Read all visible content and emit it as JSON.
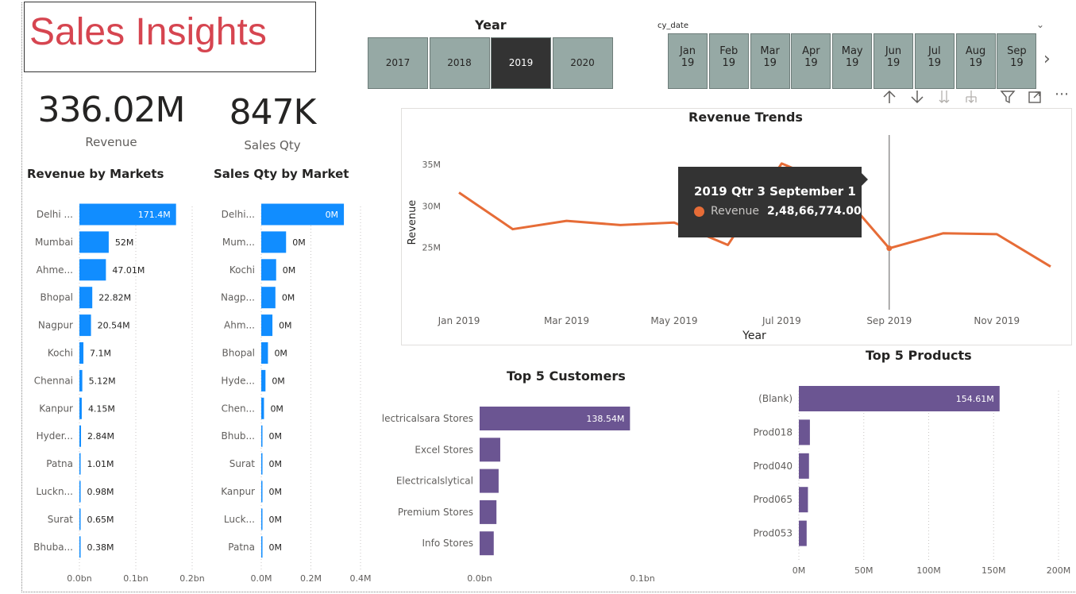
{
  "report": {
    "title": "Sales Insights"
  },
  "kpis": [
    {
      "value": "336.02M",
      "label": "Revenue"
    },
    {
      "value": "847K",
      "label": "Sales Qty"
    }
  ],
  "year_slicer": {
    "title": "Year",
    "years": [
      "2017",
      "2018",
      "2019",
      "2020"
    ],
    "selected": "2019"
  },
  "date_slicer": {
    "title": "cy_date",
    "months": [
      {
        "m": "Jan",
        "y": "19"
      },
      {
        "m": "Feb",
        "y": "19"
      },
      {
        "m": "Mar",
        "y": "19"
      },
      {
        "m": "Apr",
        "y": "19"
      },
      {
        "m": "May",
        "y": "19"
      },
      {
        "m": "Jun",
        "y": "19"
      },
      {
        "m": "Jul",
        "y": "19"
      },
      {
        "m": "Aug",
        "y": "19"
      },
      {
        "m": "Sep",
        "y": "19"
      }
    ]
  },
  "visual_header_icons": [
    "arrow-up-icon",
    "arrow-down-icon",
    "double-arrow-down-icon",
    "expand-hierarchy-icon",
    "filter-icon",
    "focus-mode-icon",
    "more-options-icon"
  ],
  "colors": {
    "blue": "#118dff",
    "orange": "#e66c37",
    "purple": "#6b5592",
    "title_red": "#d64550",
    "slicer": "#96a9a5",
    "selected": "#333333"
  },
  "chart_data": [
    {
      "id": "revenue_by_markets",
      "type": "bar",
      "title": "Revenue by Markets",
      "orientation": "horizontal",
      "categories": [
        "Delhi ...",
        "Mumbai",
        "Ahme...",
        "Bhopal",
        "Nagpur",
        "Kochi",
        "Chennai",
        "Kanpur",
        "Hyder...",
        "Patna",
        "Luckn...",
        "Surat",
        "Bhuba..."
      ],
      "values": [
        171.4,
        52,
        47.01,
        22.82,
        20.54,
        7.1,
        5.12,
        4.15,
        2.84,
        1.01,
        0.98,
        0.65,
        0.38
      ],
      "labels": [
        "171.4M",
        "52M",
        "47.01M",
        "22.82M",
        "20.54M",
        "7.1M",
        "5.12M",
        "4.15M",
        "2.84M",
        "1.01M",
        "0.98M",
        "0.65M",
        "0.38M"
      ],
      "xticks": [
        "0.0bn",
        "0.1bn",
        "0.2bn"
      ],
      "xlim": [
        0,
        200
      ],
      "grid": true
    },
    {
      "id": "sales_qty_by_market",
      "type": "bar",
      "title": "Sales Qty by Market",
      "orientation": "horizontal",
      "categories": [
        "Delhi...",
        "Mum...",
        "Kochi",
        "Nagp...",
        "Ahm...",
        "Bhopal",
        "Hyde...",
        "Chen...",
        "Bhub...",
        "Surat",
        "Kanpur",
        "Luck...",
        "Patna"
      ],
      "values": [
        0.333,
        0.1,
        0.06,
        0.057,
        0.045,
        0.027,
        0.017,
        0.011,
        0.004,
        0.002,
        0.002,
        0.001,
        0.001
      ],
      "labels": [
        "0M",
        "0M",
        "0M",
        "0M",
        "0M",
        "0M",
        "0M",
        "0M",
        "0M",
        "0M",
        "0M",
        "0M",
        "0M"
      ],
      "xticks": [
        "0.0M",
        "0.2M",
        "0.4M"
      ],
      "xlim": [
        0,
        0.4
      ],
      "grid": true
    },
    {
      "id": "revenue_trends",
      "type": "line",
      "title": "Revenue Trends",
      "xlabel": "Year",
      "ylabel": "Revenue",
      "x": [
        "2019-01",
        "2019-02",
        "2019-03",
        "2019-04",
        "2019-05",
        "2019-06",
        "2019-07",
        "2019-08",
        "2019-09",
        "2019-10",
        "2019-11",
        "2019-12"
      ],
      "xticks": [
        "Jan 2019",
        "Mar 2019",
        "May 2019",
        "Jul 2019",
        "Sep 2019",
        "Nov 2019"
      ],
      "values": [
        31.6,
        27.2,
        28.2,
        27.7,
        28.0,
        25.3,
        35.1,
        32.4,
        24.9,
        26.7,
        26.6,
        22.7
      ],
      "yticks": [
        "25M",
        "30M",
        "35M"
      ],
      "ylim": [
        22,
        37
      ],
      "series": [
        {
          "name": "Revenue",
          "color": "#e66c37"
        }
      ],
      "tooltip": {
        "title": "2019 Qtr 3 September 1",
        "series": "Revenue",
        "value": "2,48,66,774.00",
        "index": 8
      }
    },
    {
      "id": "top5_customers",
      "type": "bar",
      "title": "Top 5 Customers",
      "orientation": "horizontal",
      "categories": [
        "Electricalsara Stores",
        "Excel Stores",
        "Electricalslytical",
        "Premium Stores",
        "Info Stores"
      ],
      "values": [
        138.54,
        19,
        17.5,
        15.5,
        13
      ],
      "labels": [
        "138.54M",
        "",
        "",
        "",
        ""
      ],
      "xticks": [
        "0.0bn",
        "0.1bn"
      ],
      "xlim": [
        0,
        150
      ],
      "grid": false
    },
    {
      "id": "top5_products",
      "type": "bar",
      "title": "Top 5 Products",
      "orientation": "horizontal",
      "categories": [
        "(Blank)",
        "Prod018",
        "Prod040",
        "Prod065",
        "Prod053"
      ],
      "values": [
        154.61,
        8.5,
        7.8,
        7.0,
        6.0
      ],
      "labels": [
        "154.61M",
        "",
        "",
        "",
        ""
      ],
      "xticks": [
        "0M",
        "50M",
        "100M",
        "150M",
        "200M"
      ],
      "xlim": [
        0,
        200
      ],
      "grid": true
    }
  ]
}
